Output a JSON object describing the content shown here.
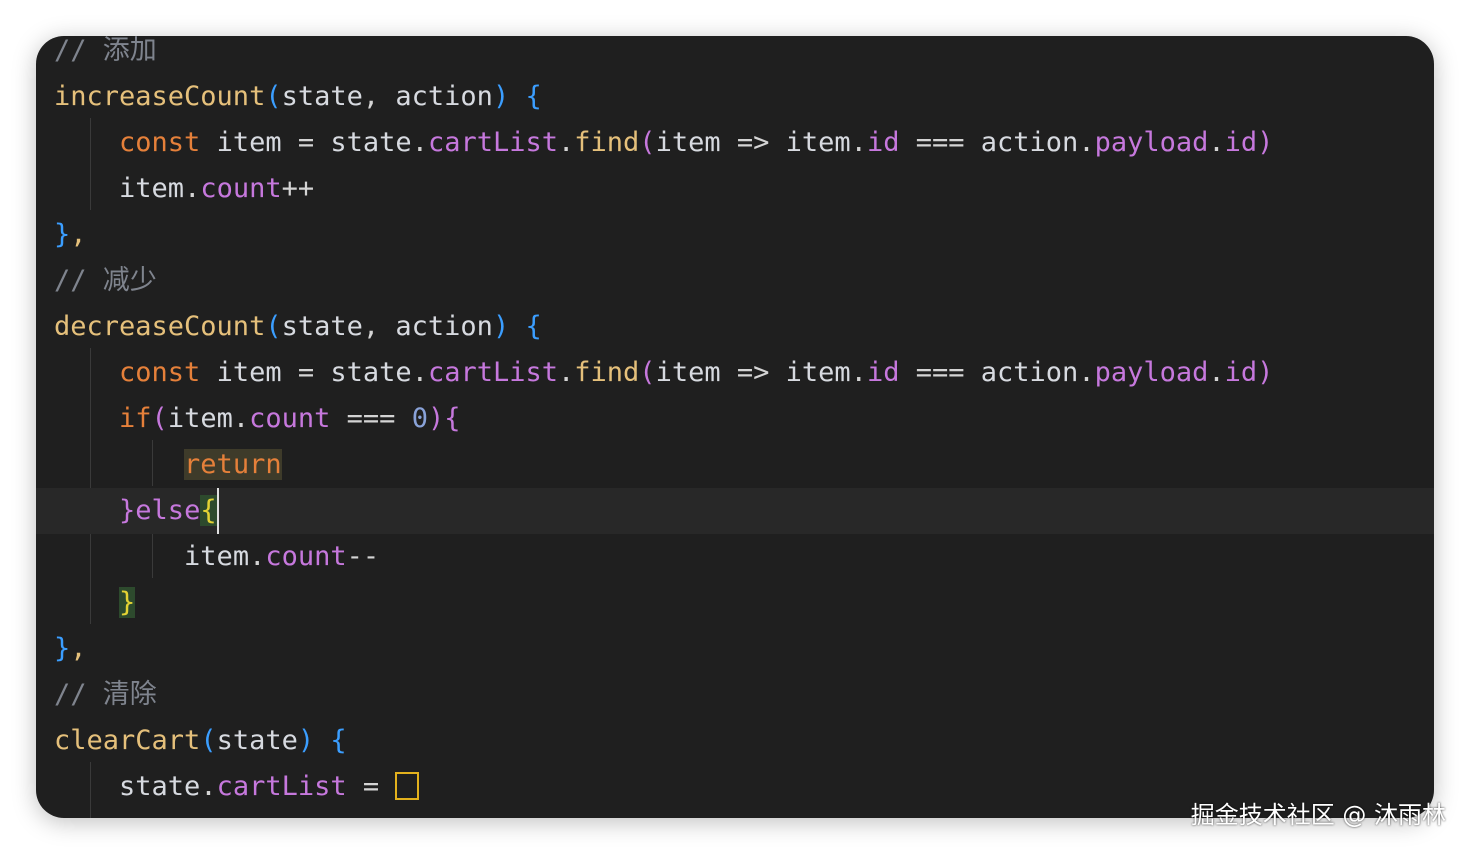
{
  "colors": {
    "background": "#1f1f1f",
    "function": "#e5c07b",
    "keyword": "#e5803a",
    "property": "#c678dd",
    "comment": "#7f848e",
    "bracket_level1": "#3b9eff",
    "bracket_level2": "#c678dd",
    "bracket_level3": "#e3d234"
  },
  "code": {
    "comment_add": "// 添加",
    "fn_increase": "increaseCount",
    "param_state": "state",
    "param_action": "action",
    "kw_const": "const",
    "var_item": "item",
    "var_state": "state",
    "prop_cartList": "cartList",
    "fn_find": "find",
    "prop_id": "id",
    "var_action": "action",
    "prop_payload": "payload",
    "prop_count": "count",
    "op_inc": "++",
    "op_dec": "--",
    "comment_decrease": "// 减少",
    "fn_decrease": "decreaseCount",
    "kw_if": "if",
    "num_zero": "0",
    "kw_return": "return",
    "kw_else": "else",
    "comment_clear": "// 清除",
    "fn_clear": "clearCart"
  },
  "watermark": "掘金技术社区 @ 沐雨林"
}
